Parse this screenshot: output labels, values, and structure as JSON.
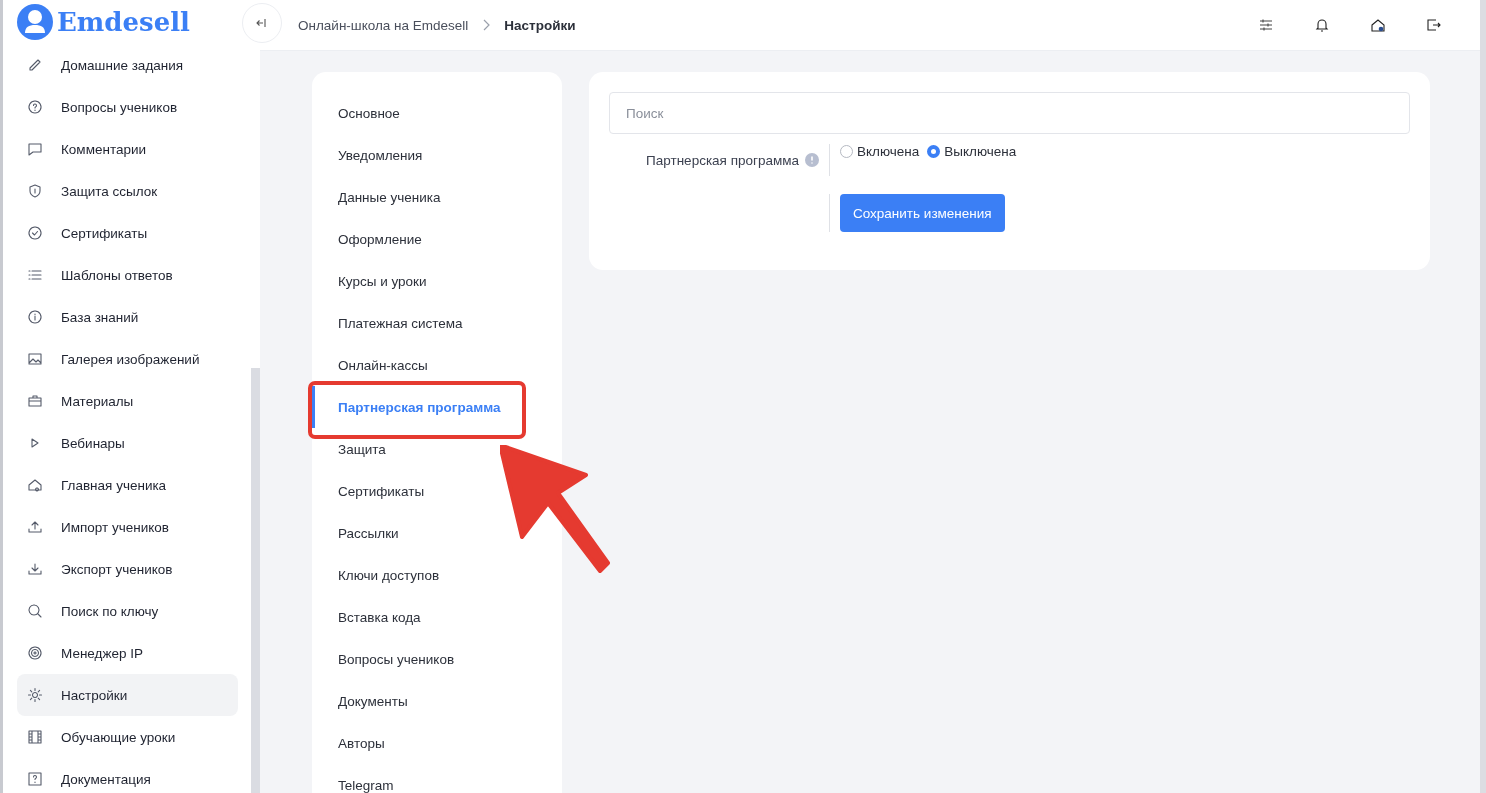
{
  "logo": {
    "text": "Emdesell"
  },
  "sidebar": {
    "items": [
      {
        "label": "Домашние задания",
        "selected": false
      },
      {
        "label": "Вопросы учеников",
        "selected": false
      },
      {
        "label": "Комментарии",
        "selected": false
      },
      {
        "label": "Защита ссылок",
        "selected": false
      },
      {
        "label": "Сертификаты",
        "selected": false
      },
      {
        "label": "Шаблоны ответов",
        "selected": false
      },
      {
        "label": "База знаний",
        "selected": false
      },
      {
        "label": "Галерея изображений",
        "selected": false
      },
      {
        "label": "Материалы",
        "selected": false
      },
      {
        "label": "Вебинары",
        "selected": false
      },
      {
        "label": "Главная ученика",
        "selected": false
      },
      {
        "label": "Импорт учеников",
        "selected": false
      },
      {
        "label": "Экспорт учеников",
        "selected": false
      },
      {
        "label": "Поиск по ключу",
        "selected": false
      },
      {
        "label": "Менеджер IP",
        "selected": false
      },
      {
        "label": "Настройки",
        "selected": true
      },
      {
        "label": "Обучающие уроки",
        "selected": false
      },
      {
        "label": "Документация",
        "selected": false
      }
    ]
  },
  "breadcrumb": [
    {
      "label": "Онлайн-школа на Emdesell"
    },
    {
      "label": "Настройки"
    }
  ],
  "settings_menu": {
    "items": [
      {
        "label": "Основное",
        "selected": false
      },
      {
        "label": "Уведомления",
        "selected": false
      },
      {
        "label": "Данные ученика",
        "selected": false
      },
      {
        "label": "Оформление",
        "selected": false
      },
      {
        "label": "Курсы и уроки",
        "selected": false
      },
      {
        "label": "Платежная система",
        "selected": false
      },
      {
        "label": "Онлайн-кассы",
        "selected": false
      },
      {
        "label": "Партнерская программа",
        "selected": true
      },
      {
        "label": "Защита",
        "selected": false
      },
      {
        "label": "Сертификаты",
        "selected": false
      },
      {
        "label": "Рассылки",
        "selected": false
      },
      {
        "label": "Ключи доступов",
        "selected": false
      },
      {
        "label": "Вставка кода",
        "selected": false
      },
      {
        "label": "Вопросы учеников",
        "selected": false
      },
      {
        "label": "Документы",
        "selected": false
      },
      {
        "label": "Авторы",
        "selected": false
      },
      {
        "label": "Telegram",
        "selected": false
      }
    ]
  },
  "form": {
    "search": {
      "placeholder": "Поиск"
    },
    "field": {
      "label": "Партнерская программа",
      "options": [
        {
          "label": "Включена",
          "selected": false
        },
        {
          "label": "Выключена",
          "selected": true
        }
      ]
    },
    "save_button": "Сохранить изменения"
  }
}
